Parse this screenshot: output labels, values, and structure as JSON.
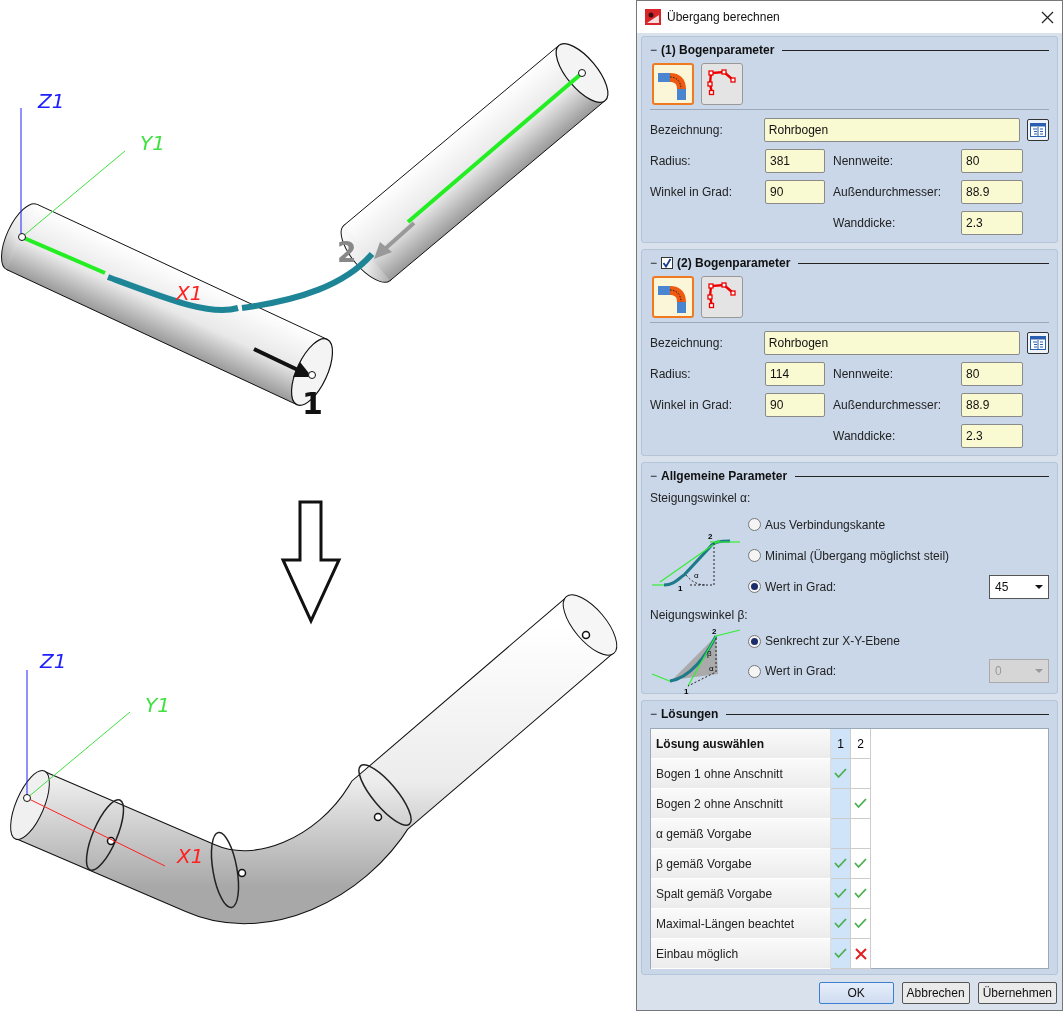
{
  "viewport": {
    "before": {
      "labels": [
        {
          "kind": "z",
          "text": "Z1",
          "color": "#2020ff"
        },
        {
          "kind": "y",
          "text": "Y1",
          "color": "#40e040"
        },
        {
          "kind": "x",
          "text": "X1",
          "color": "#ff2020"
        },
        {
          "kind": "point1",
          "text": "1",
          "color": "#111111"
        },
        {
          "kind": "point2",
          "text": "2",
          "color": "#888888"
        }
      ]
    },
    "after": {
      "labels": [
        {
          "kind": "z",
          "text": "Z1",
          "color": "#2020ff"
        },
        {
          "kind": "y",
          "text": "Y1",
          "color": "#40e040"
        },
        {
          "kind": "x",
          "text": "X1",
          "color": "#ff2020"
        }
      ]
    }
  },
  "dialog": {
    "title": "Übergang berechnen",
    "bend_sections": [
      {
        "toggle": "−",
        "title": "(1) Bogenparameter",
        "modes": [
          {
            "kind": "bend",
            "selected": true
          },
          {
            "kind": "polyline",
            "selected": false
          }
        ],
        "designation": {
          "label": "Bezeichnung:",
          "value": "Rohrbogen"
        },
        "left": [
          {
            "label": "Radius:",
            "value": "381"
          },
          {
            "label": "Winkel in Grad:",
            "value": "90"
          }
        ],
        "right": [
          {
            "label": "Nennweite:",
            "value": "80"
          },
          {
            "label": "Außendurchmesser:",
            "value": "88.9"
          },
          {
            "label": "Wanddicke:",
            "value": "2.3"
          }
        ]
      },
      {
        "toggle": "−",
        "title": "(2) Bogenparameter",
        "checked": true,
        "modes": [
          {
            "kind": "bend",
            "selected": true
          },
          {
            "kind": "polyline",
            "selected": false
          }
        ],
        "designation": {
          "label": "Bezeichnung:",
          "value": "Rohrbogen"
        },
        "left": [
          {
            "label": "Radius:",
            "value": "114"
          },
          {
            "label": "Winkel in Grad:",
            "value": "90"
          }
        ],
        "right": [
          {
            "label": "Nennweite:",
            "value": "80"
          },
          {
            "label": "Außendurchmesser:",
            "value": "88.9"
          },
          {
            "label": "Wanddicke:",
            "value": "2.3"
          }
        ]
      }
    ],
    "general": {
      "toggle": "−",
      "title": "Allgemeine Parameter",
      "groups": [
        {
          "kind": "alpha",
          "label": "Steigungswinkel α:",
          "diagram_labels": [
            "2",
            "α",
            "1"
          ],
          "options": [
            {
              "label": "Aus Verbindungskante",
              "selected": false
            },
            {
              "label": "Minimal (Übergang möglichst steil)",
              "selected": false
            },
            {
              "label": "Wert in Grad:",
              "selected": true
            }
          ],
          "dropdown": {
            "value": "45",
            "disabled": false
          }
        },
        {
          "kind": "beta",
          "label": "Neigungswinkel β:",
          "diagram_labels": [
            "2",
            "β",
            "α",
            "1"
          ],
          "options": [
            {
              "label": "Senkrecht zur X-Y-Ebene",
              "selected": true
            },
            {
              "label": "Wert in Grad:",
              "selected": false
            }
          ],
          "dropdown": {
            "value": "0",
            "disabled": true
          }
        }
      ]
    },
    "solutions": {
      "toggle": "−",
      "title": "Lösungen",
      "header": "Lösung auswählen",
      "columns": [
        {
          "label": "1",
          "selected": true
        },
        {
          "label": "2",
          "selected": false
        }
      ],
      "rows": [
        {
          "label": "Bogen 1 ohne Anschnitt",
          "cells": [
            {
              "kind": "check"
            },
            {
              "kind": "none"
            }
          ]
        },
        {
          "label": "Bogen 2 ohne Anschnitt",
          "cells": [
            {
              "kind": "none"
            },
            {
              "kind": "check"
            }
          ]
        },
        {
          "label": "α gemäß Vorgabe",
          "cells": [
            {
              "kind": "none"
            },
            {
              "kind": "none"
            }
          ]
        },
        {
          "label": "β gemäß Vorgabe",
          "cells": [
            {
              "kind": "check"
            },
            {
              "kind": "check"
            }
          ]
        },
        {
          "label": "Spalt gemäß Vorgabe",
          "cells": [
            {
              "kind": "check"
            },
            {
              "kind": "check"
            }
          ]
        },
        {
          "label": "Maximal-Längen beachtet",
          "cells": [
            {
              "kind": "check"
            },
            {
              "kind": "check"
            }
          ]
        },
        {
          "label": "Einbau möglich",
          "cells": [
            {
              "kind": "check"
            },
            {
              "kind": "cross"
            }
          ]
        }
      ]
    },
    "buttons": [
      {
        "label": "OK",
        "default": true
      },
      {
        "label": "Abbrechen",
        "default": false
      },
      {
        "label": "Übernehmen",
        "default": false
      }
    ]
  }
}
